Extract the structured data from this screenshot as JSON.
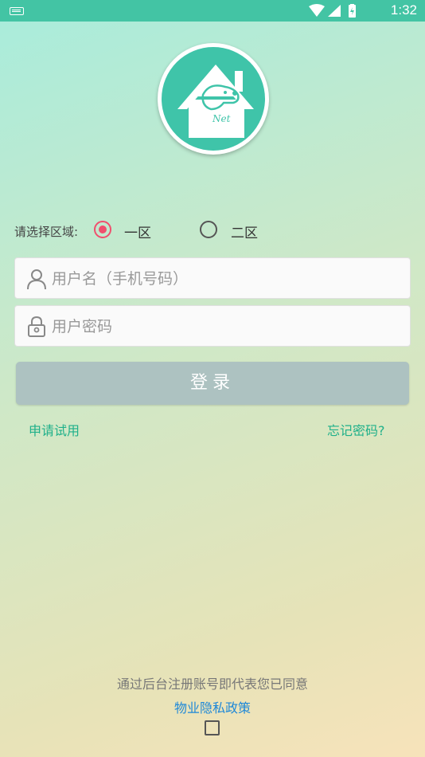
{
  "status_bar": {
    "time": "1:32"
  },
  "logo": {
    "text": "Net"
  },
  "area": {
    "label": "请选择区域:",
    "options": [
      {
        "label": "一区",
        "selected": true
      },
      {
        "label": "二区",
        "selected": false
      }
    ]
  },
  "login_form": {
    "username_placeholder": "用户名（手机号码）",
    "password_placeholder": "用户密码",
    "login_label": "登录"
  },
  "links": {
    "apply_trial": "申请试用",
    "forgot_password": "忘记密码?"
  },
  "agreement": {
    "text": "通过后台注册账号即代表您已同意",
    "policy_link": "物业隐私政策",
    "checked": false
  },
  "colors": {
    "accent": "#3fc4a9",
    "radio_selected": "#f04f6d",
    "link_green": "#1fb08a",
    "link_blue": "#1e88d8",
    "button_disabled": "#adc2c1"
  }
}
